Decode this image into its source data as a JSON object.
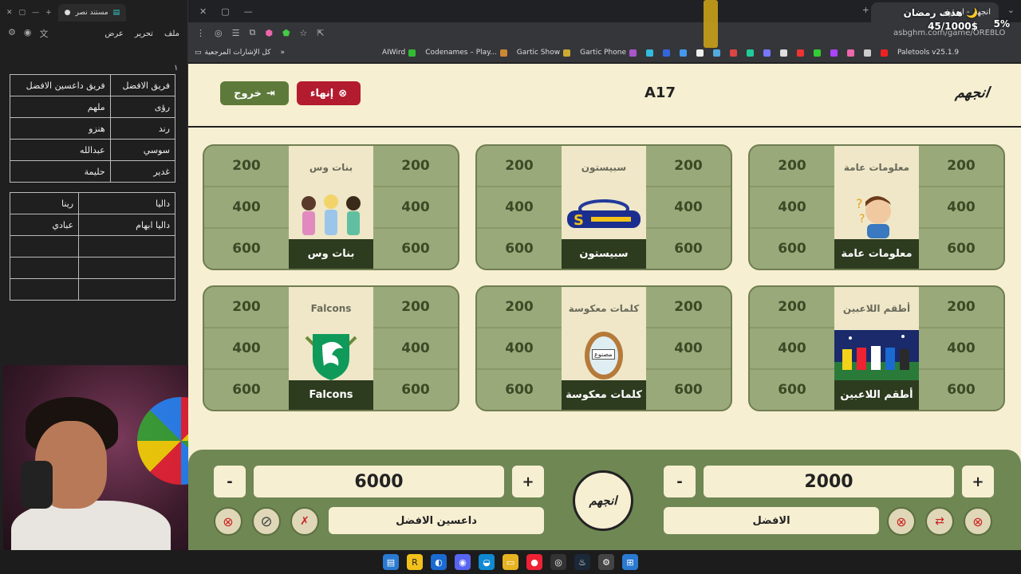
{
  "doc": {
    "tab_title": "مستند نصر",
    "menu": [
      "ملف",
      "تحرير",
      "عرض"
    ],
    "marker": "١",
    "table1": [
      [
        "فريق داعسين الافضل",
        "فريق الافضل"
      ],
      [
        "ملهم",
        "رؤى"
      ],
      [
        "هنزو",
        "رند"
      ],
      [
        "عبدالله",
        "سوسي"
      ],
      [
        "حليمة",
        "غدير"
      ]
    ],
    "table2": [
      [
        "رينا",
        "داليا"
      ],
      [
        "عبادي",
        "داليا ابهام"
      ],
      [
        "",
        ""
      ],
      [
        "",
        ""
      ],
      [
        "",
        ""
      ]
    ]
  },
  "browser": {
    "url": "asbghm.com/game/ORE8LO",
    "right_tab": "انجهم - اسقهم",
    "bookmarks": [
      "كل الإشارات المرجعية",
      "AIWird",
      "Codenames – Play...",
      "Gartic Show",
      "Gartic Phone",
      "Paletools v25.1.9"
    ]
  },
  "overlay": {
    "title": "هدف رمضان 🌙",
    "goal": "45/1000$",
    "percent": "5%"
  },
  "game": {
    "logo": "انجهم",
    "room_code": "A17",
    "end_label": "إنهاء",
    "exit_label": "خروج",
    "categories": [
      {
        "title": "معلومات عامة",
        "label": "معلومات عامة",
        "points": [
          "200",
          "400",
          "600"
        ]
      },
      {
        "title": "سبيستون",
        "label": "سبيستون",
        "points": [
          "200",
          "400",
          "600"
        ]
      },
      {
        "title": "بنات وس",
        "label": "بنات وس",
        "points": [
          "200",
          "400",
          "600"
        ]
      },
      {
        "title": "أطقم اللاعبين",
        "label": "أطقم اللاعبين",
        "points": [
          "200",
          "400",
          "600"
        ]
      },
      {
        "title": "كلمات معكوسة",
        "label": "كلمات معكوسة",
        "points": [
          "200",
          "400",
          "600"
        ]
      },
      {
        "title": "Falcons",
        "label": "Falcons",
        "points": [
          "200",
          "400",
          "600"
        ]
      }
    ],
    "mirror_word": "مصنوع",
    "team_right": {
      "name": "الافضل",
      "score": "2000"
    },
    "team_left": {
      "name": "داعسين الافضل",
      "score": "6000"
    },
    "plus": "+",
    "minus": "-",
    "center_logo": "انجهم"
  },
  "colors": {
    "bg": "#f7efd2",
    "card": "#9aa979",
    "dark": "#2d3b1f",
    "end": "#b31b2f",
    "exit": "#5e7a3a",
    "panel": "#6f8753"
  }
}
